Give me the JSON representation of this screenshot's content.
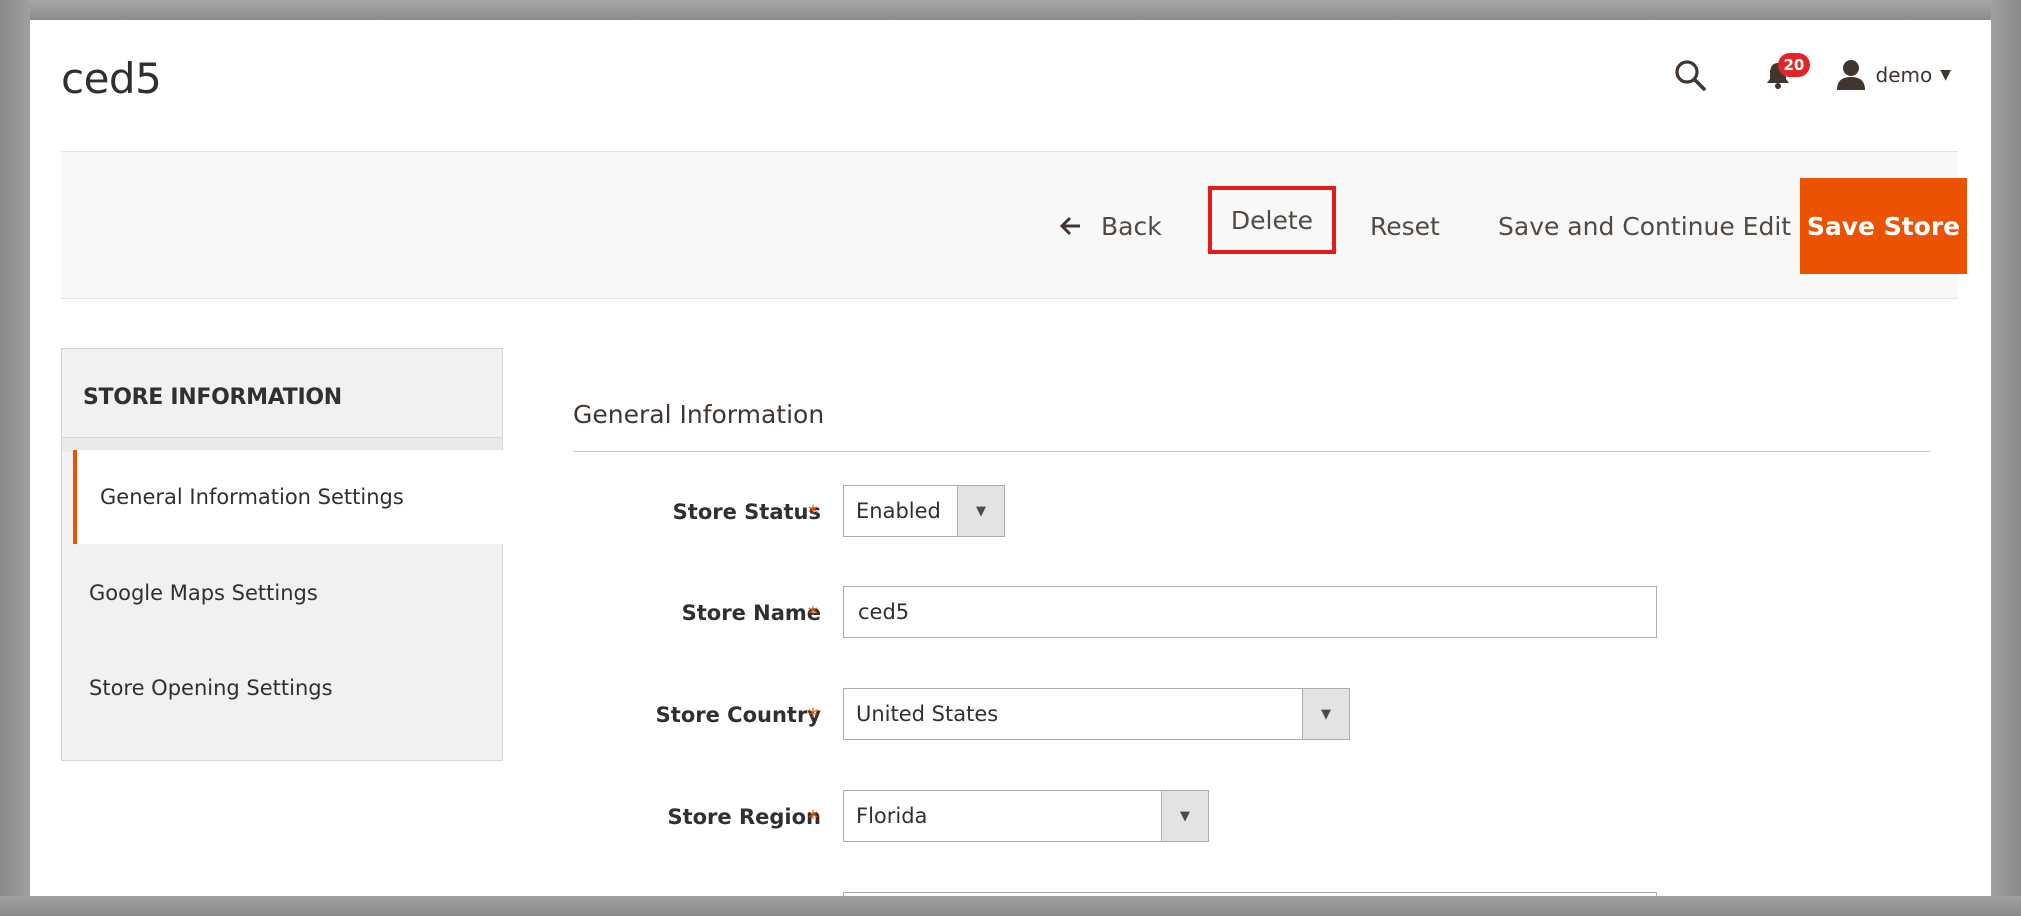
{
  "header": {
    "page_title": "ced5",
    "notification_count": "20",
    "user_name": "demo"
  },
  "toolbar": {
    "back_label": "Back",
    "delete_label": "Delete",
    "reset_label": "Reset",
    "save_continue_label": "Save and Continue Edit",
    "save_store_label": "Save Store"
  },
  "sidebar": {
    "title": "STORE INFORMATION",
    "items": [
      {
        "label": "General Information Settings",
        "active": true
      },
      {
        "label": "Google Maps Settings",
        "active": false
      },
      {
        "label": "Store Opening Settings",
        "active": false
      }
    ]
  },
  "form": {
    "section_title": "General Information",
    "required_marker": "*",
    "fields": {
      "store_status": {
        "label": "Store Status",
        "value": "Enabled"
      },
      "store_name": {
        "label": "Store Name",
        "value": "ced5"
      },
      "store_country": {
        "label": "Store Country",
        "value": "United States"
      },
      "store_region": {
        "label": "Store Region",
        "value": "Florida"
      }
    }
  },
  "colors": {
    "accent": "#eb5202",
    "highlight_border": "#e41c1c",
    "badge": "#e22626"
  },
  "icons": {
    "search": "search-icon",
    "notifications": "bell-icon",
    "user": "user-icon",
    "back": "arrow-left-icon",
    "dropdown": "triangle-down-icon"
  }
}
